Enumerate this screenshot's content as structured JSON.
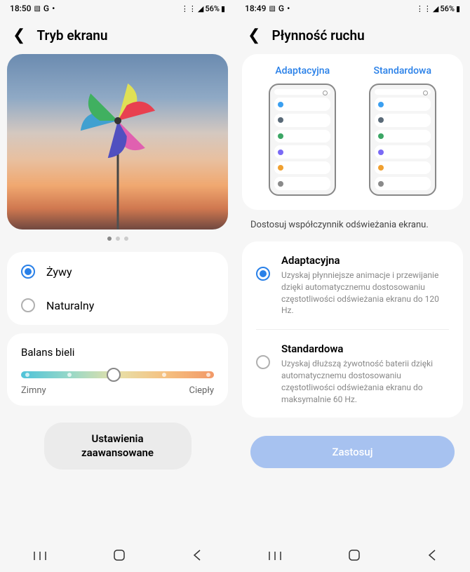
{
  "left": {
    "status": {
      "time": "18:50",
      "icons": "G",
      "battery": "56%"
    },
    "title": "Tryb ekranu",
    "options": [
      {
        "label": "Żywy",
        "checked": true
      },
      {
        "label": "Naturalny",
        "checked": false
      }
    ],
    "white_balance": {
      "title": "Balans bieli",
      "cold": "Zimny",
      "warm": "Ciepły"
    },
    "advanced": "Ustawienia zaawansowane"
  },
  "right": {
    "status": {
      "time": "18:49",
      "icons": "G",
      "battery": "56%"
    },
    "title": "Płynność ruchu",
    "previews": [
      "Adaptacyjna",
      "Standardowa"
    ],
    "description": "Dostosuj współczynnik odświeżania ekranu.",
    "options": [
      {
        "title": "Adaptacyjna",
        "desc": "Uzyskaj płynniejsze animacje i przewijanie dzięki automatycznemu dostosowaniu częstotliwości odświeżania ekranu do 120 Hz.",
        "checked": true
      },
      {
        "title": "Standardowa",
        "desc": "Uzyskaj dłuższą żywotność baterii dzięki automatycznemu dostosowaniu częstotliwości odświeżania ekranu do maksymalnie 60 Hz.",
        "checked": false
      }
    ],
    "apply": "Zastosuj"
  },
  "mock_colors": [
    "#3b9ff0",
    "#5a6a78",
    "#3ca665",
    "#7a6af5",
    "#f0a030",
    "#8a8a8a"
  ]
}
